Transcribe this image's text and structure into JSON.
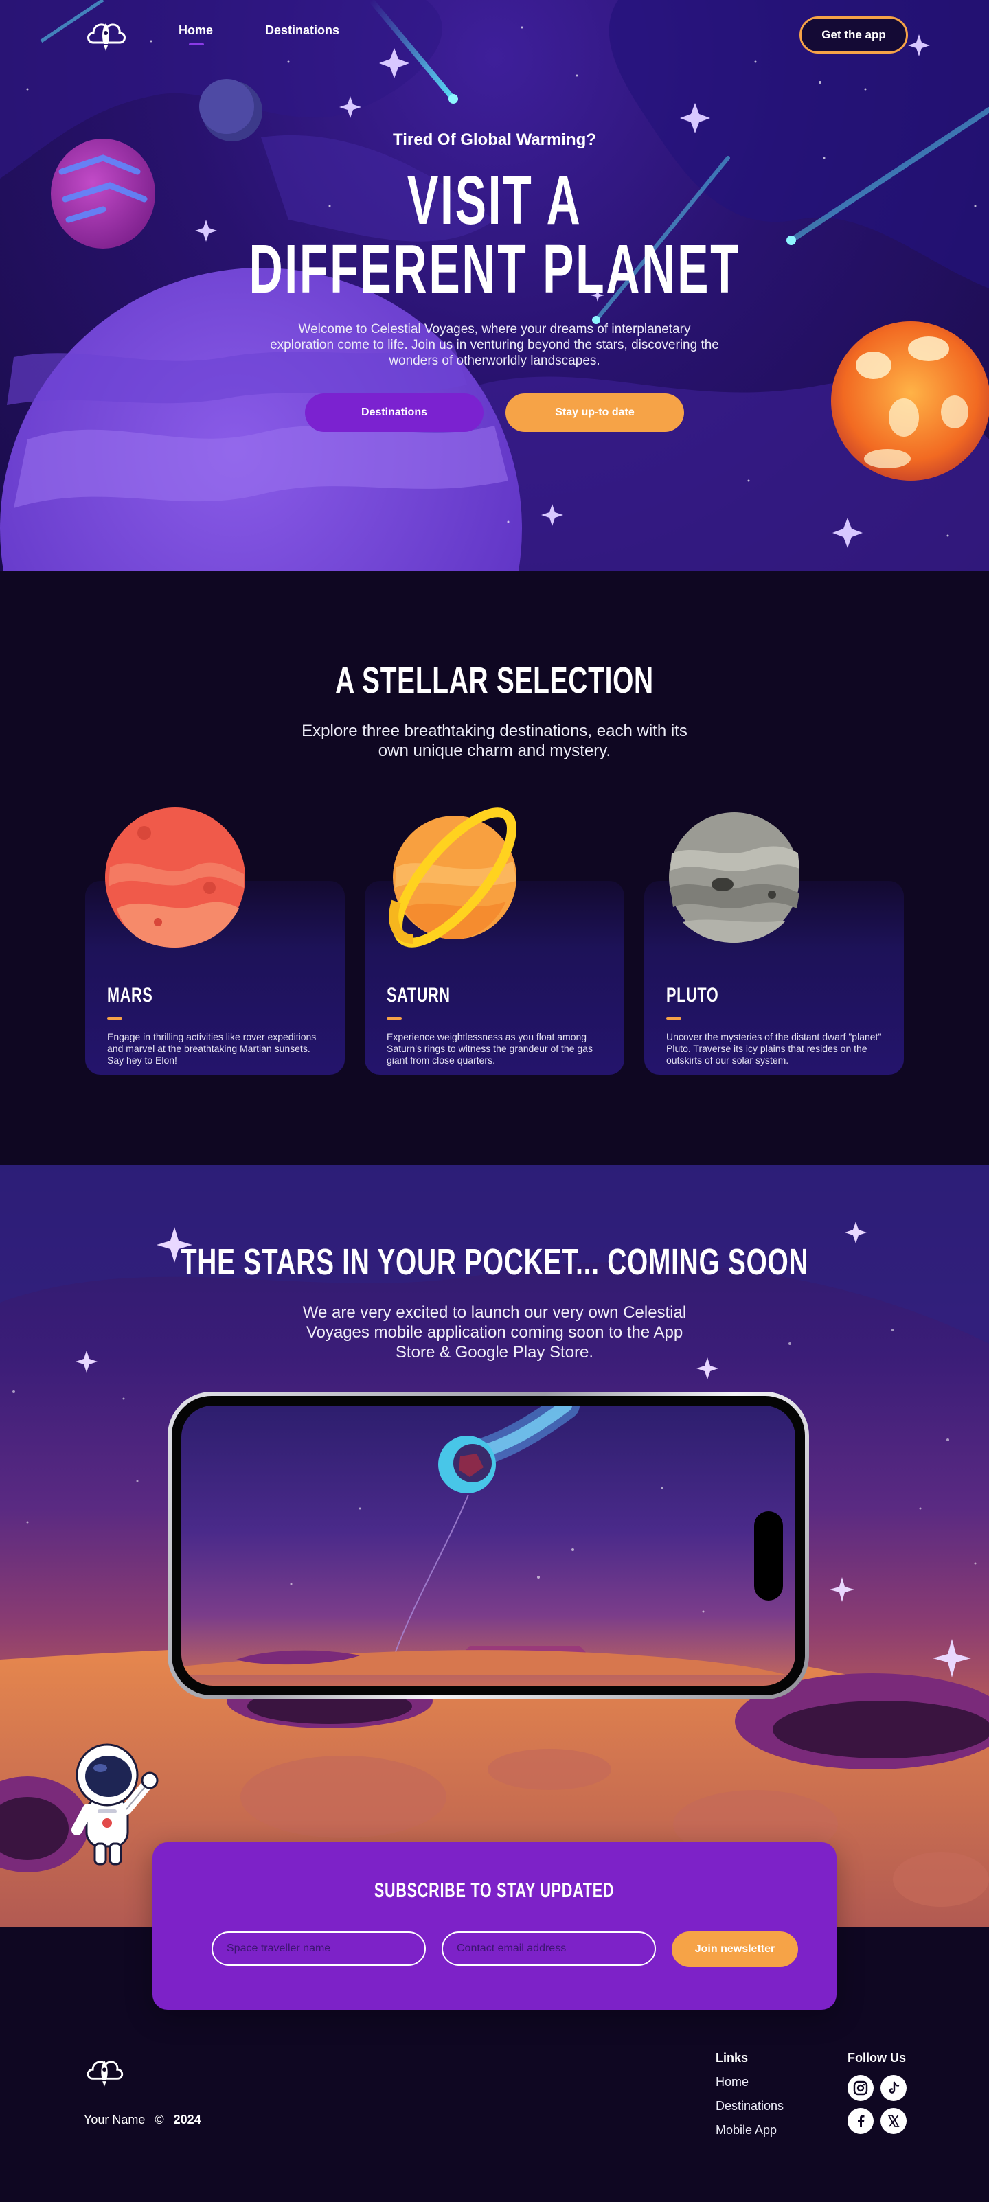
{
  "nav": {
    "links": [
      {
        "label": "Home"
      },
      {
        "label": "Destinations"
      }
    ],
    "cta": "Get the app"
  },
  "hero": {
    "eyebrow": "Tired Of Global Warming?",
    "title_line1": "VISIT A",
    "title_line2": "DIFFERENT PLANET",
    "text": "Welcome to Celestial Voyages, where your dreams of interplanetary exploration come to life. Join us in venturing beyond the stars, discovering the wonders of otherworldly landscapes.",
    "btn_primary": "Destinations",
    "btn_secondary": "Stay up-to date"
  },
  "selection": {
    "title": "A STELLAR SELECTION",
    "subtitle": "Explore three breathtaking destinations, each with its own unique charm and mystery.",
    "cards": [
      {
        "title": "MARS",
        "text": "Engage in thrilling activities like rover expeditions and marvel at the breathtaking Martian sunsets. Say hey to Elon!"
      },
      {
        "title": "SATURN",
        "text": "Experience weightlessness as you float among Saturn's rings to witness the grandeur of the gas giant from close quarters."
      },
      {
        "title": "PLUTO",
        "text": "Uncover the mysteries of the distant dwarf \"planet\" Pluto. Traverse its icy plains that resides on the outskirts of our solar system."
      }
    ]
  },
  "soon": {
    "title": "THE STARS IN YOUR POCKET... COMING SOON",
    "text": "We are very excited to launch our very own Celestial Voyages mobile application coming soon to the App Store & Google Play Store."
  },
  "subscribe": {
    "title": "SUBSCRIBE TO STAY UPDATED",
    "name_placeholder": "Space traveller name",
    "email_placeholder": "Contact email address",
    "button": "Join newsletter"
  },
  "footer": {
    "name": "Your Name",
    "copyright_symbol": "©",
    "year": "2024",
    "links_heading": "Links",
    "links": [
      {
        "label": "Home"
      },
      {
        "label": "Destinations"
      },
      {
        "label": "Mobile App"
      }
    ],
    "follow_heading": "Follow Us",
    "socials": [
      "instagram-icon",
      "tiktok-icon",
      "facebook-icon",
      "x-icon"
    ]
  },
  "colors": {
    "accent_orange": "#f6a347",
    "accent_purple": "#7b22d0",
    "background": "#0f0722",
    "card": "#1d1258"
  }
}
